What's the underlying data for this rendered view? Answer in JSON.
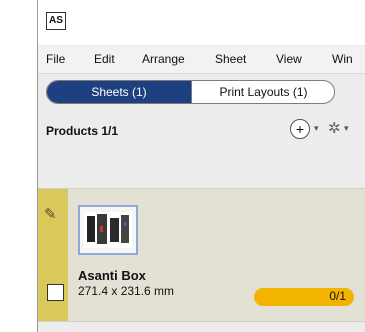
{
  "app": {
    "logo_text": "AS"
  },
  "menu": [
    "File",
    "Edit",
    "Arrange",
    "Sheet",
    "View",
    "Win"
  ],
  "tabs": {
    "sheets": "Sheets (1)",
    "print_layouts": "Print Layouts (1)"
  },
  "panel": {
    "title": "Products 1/1",
    "add_symbol": "+",
    "caret": "▾",
    "gear_symbol": "✲"
  },
  "products": [
    {
      "name": "Asanti Box",
      "size": "271.4 x 231.6 mm",
      "progress_label": "0/1",
      "progress_value": 0.0
    }
  ],
  "colors": {
    "accent_tab": "#1e3f80",
    "progress": "#f2b400",
    "row_band": "#d9c95a"
  }
}
